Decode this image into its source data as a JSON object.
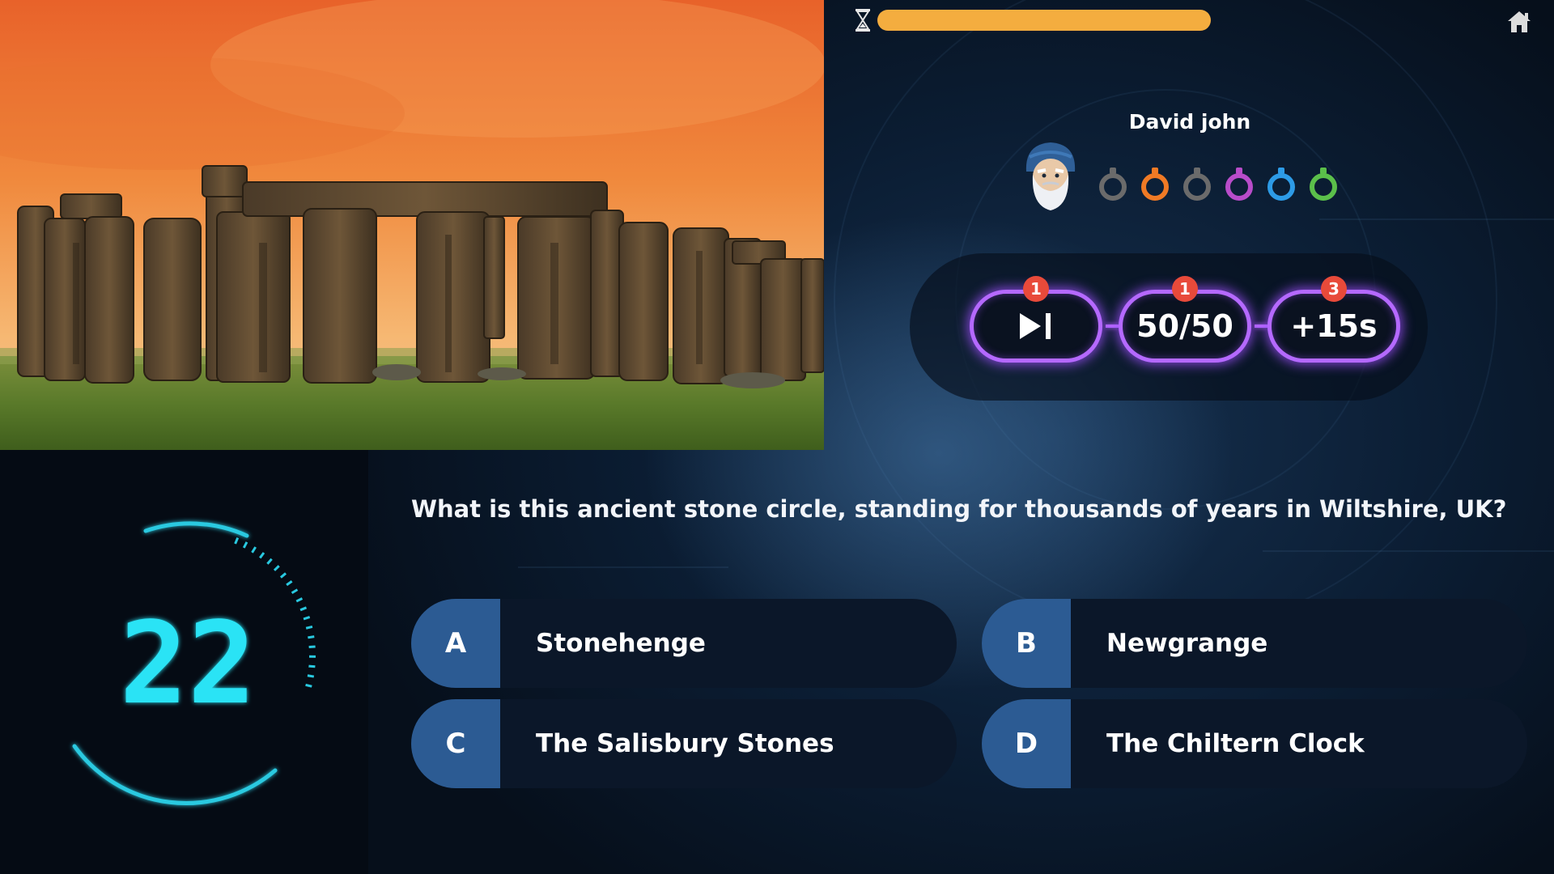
{
  "timer": {
    "remaining_fraction": 1.0
  },
  "player": {
    "name": "David john",
    "avatar": "wizard-avatar",
    "tokens": [
      {
        "color": "#6b6b6b",
        "filled": false
      },
      {
        "color": "#f07a25",
        "filled": true
      },
      {
        "color": "#6b6b6b",
        "filled": false
      },
      {
        "color": "#b84cc9",
        "filled": true
      },
      {
        "color": "#2d9be6",
        "filled": true
      },
      {
        "color": "#5bbf4a",
        "filled": true
      }
    ]
  },
  "lifelines": [
    {
      "icon": "skip-icon",
      "label": "",
      "count": "1"
    },
    {
      "icon": "",
      "label": "50/50",
      "count": "1"
    },
    {
      "icon": "",
      "label": "+15s",
      "count": "3"
    }
  ],
  "question": {
    "text": "What is this ancient stone circle, standing for thousands of years in Wiltshire, UK?",
    "image": "stonehenge-photo"
  },
  "answers": [
    {
      "letter": "A",
      "text": "Stonehenge"
    },
    {
      "letter": "B",
      "text": "Newgrange"
    },
    {
      "letter": "C",
      "text": "The Salisbury Stones"
    },
    {
      "letter": "D",
      "text": "The Chiltern Clock"
    }
  ],
  "countdown": {
    "seconds": "22"
  },
  "colors": {
    "timer_bar": "#f4ad3f",
    "lifeline_glow": "#b569ff",
    "badge": "#e84a3a",
    "answer_letter_bg": "#2c5b93",
    "countdown_digits": "#29e3f5"
  }
}
